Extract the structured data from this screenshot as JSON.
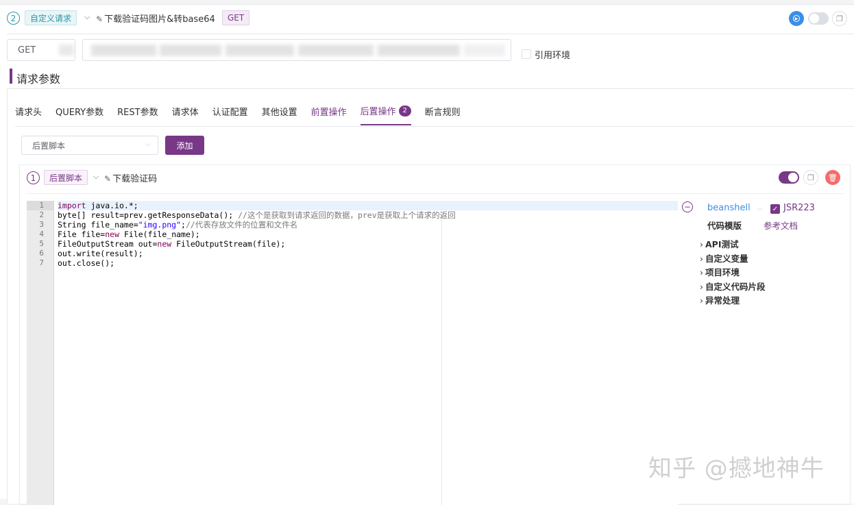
{
  "header": {
    "step_number": "2",
    "type_tag": "自定义请求",
    "title": "下载验证码图片&转base64",
    "method_tag": "GET"
  },
  "url_row": {
    "method": "GET",
    "use_env_label": "引用环境"
  },
  "section": {
    "title": "请求参数"
  },
  "tabs": [
    {
      "label": "请求头"
    },
    {
      "label": "QUERY参数"
    },
    {
      "label": "REST参数"
    },
    {
      "label": "请求体"
    },
    {
      "label": "认证配置"
    },
    {
      "label": "其他设置"
    },
    {
      "label": "前置操作"
    },
    {
      "label": "后置操作",
      "badge": "2"
    },
    {
      "label": "断言规则"
    }
  ],
  "toolbar": {
    "select_value": "后置脚本",
    "add_label": "添加"
  },
  "script": {
    "step_number": "1",
    "type_tag": "后置脚本",
    "title": "下载验证码",
    "language": "beanshell",
    "jsr_label": "JSR223",
    "code_template_label": "代码模版",
    "docs_label": "参考文档",
    "tree": [
      "API测试",
      "自定义变量",
      "项目环境",
      "自定义代码片段",
      "异常处理"
    ],
    "line_numbers": [
      "1",
      "2",
      "3",
      "4",
      "5",
      "6",
      "7"
    ]
  },
  "colors": {
    "accent": "#783887",
    "teal": "#2d93a8",
    "run_button": "#3a8ee6",
    "delete_button": "#f56c6c"
  },
  "watermark": "知乎 @撼地神牛"
}
